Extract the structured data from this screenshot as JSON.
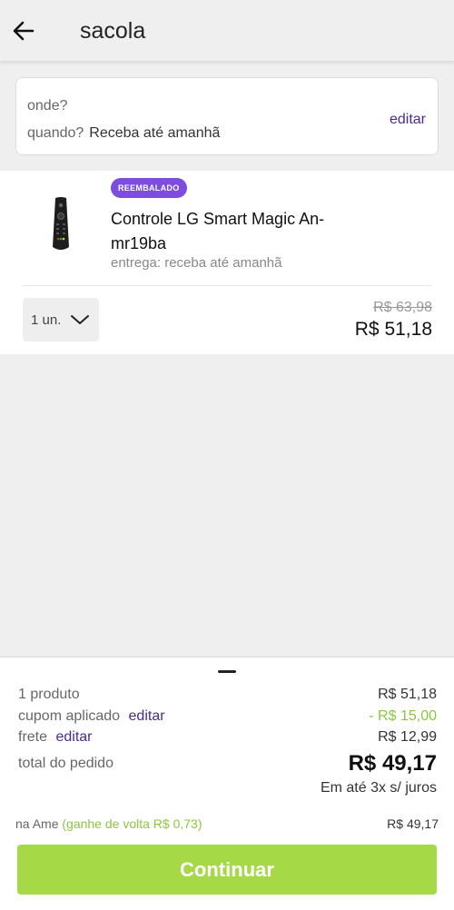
{
  "header": {
    "title": "sacola",
    "back_icon": "arrow-left-icon"
  },
  "delivery": {
    "where_label": "onde?",
    "when_label": "quando?",
    "when_value": "Receba até amanhã",
    "edit_label": "editar"
  },
  "product": {
    "badge": "REEMBALADO",
    "name": "Controle LG Smart Magic An-mr19ba",
    "delivery": "entrega: receba até amanhã",
    "quantity": "1 un.",
    "old_price": "R$ 63,98",
    "price": "R$ 51,18"
  },
  "summary": {
    "products_label": "1 produto",
    "products_value": "R$ 51,18",
    "coupon_label": "cupom aplicado",
    "coupon_edit": "editar",
    "coupon_value": "- R$ 15,00",
    "shipping_label": "frete",
    "shipping_edit": "editar",
    "shipping_value": "R$ 12,99",
    "total_label": "total do pedido",
    "total_value": "R$ 49,17",
    "installments": "Em até 3x s/ juros",
    "ame_label": "na Ame",
    "ame_cashback": "(ganhe de volta R$ 0,73)",
    "ame_value": "R$ 49,17",
    "continue_label": "Continuar"
  },
  "colors": {
    "accent_purple": "#4a2c8c",
    "badge_purple": "#7c4dde",
    "green": "#8cc63f",
    "button_green": "#a6d946"
  }
}
